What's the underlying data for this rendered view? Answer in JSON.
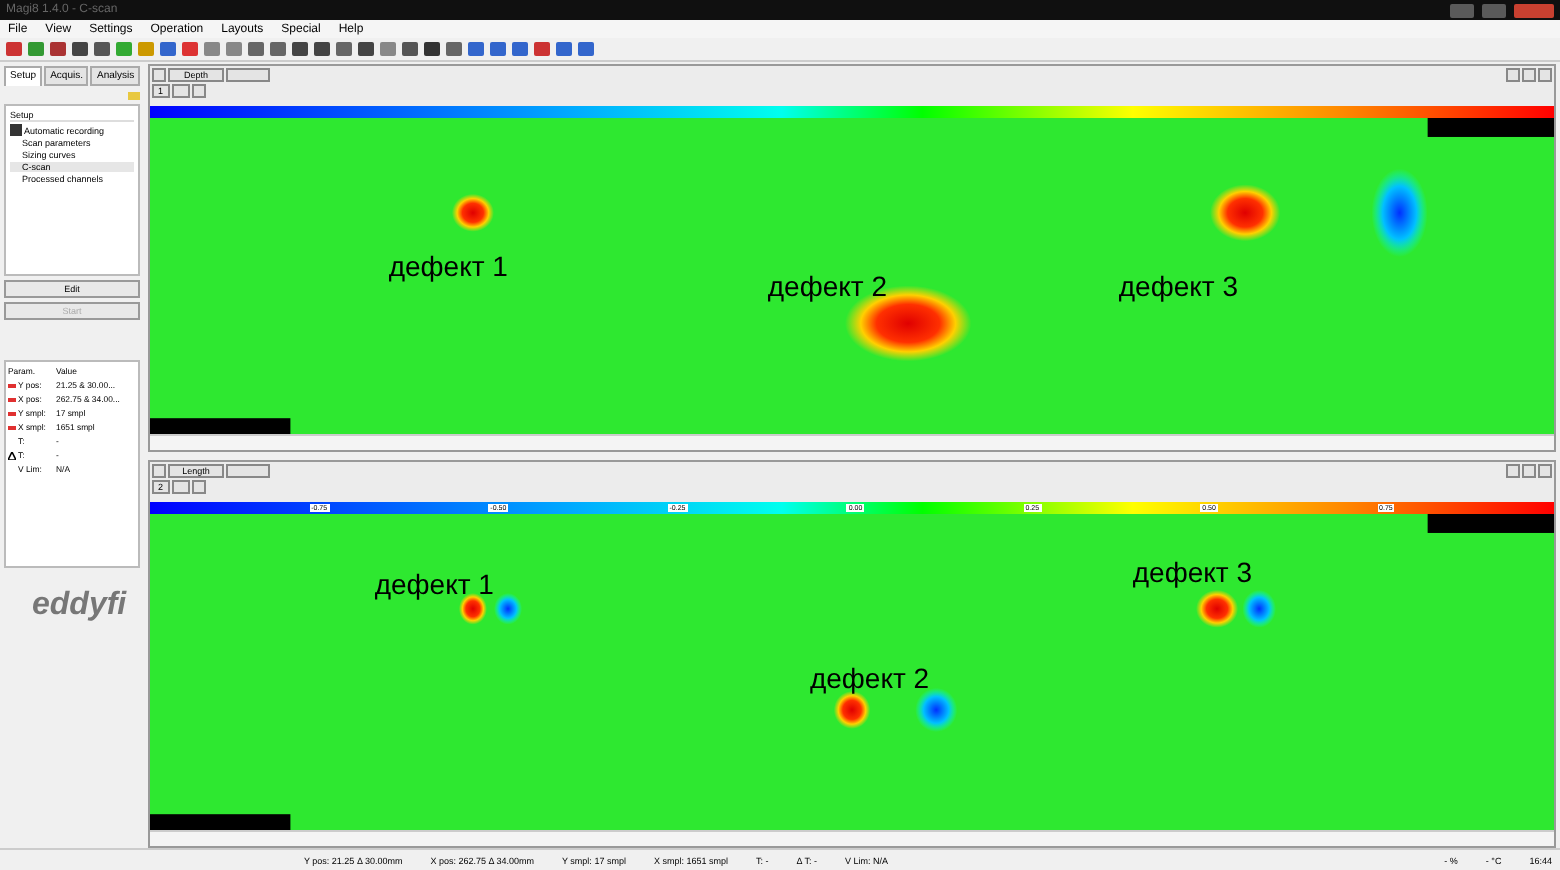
{
  "window": {
    "title": "Magi8 1.4.0 - C-scan"
  },
  "menu": [
    "File",
    "View",
    "Settings",
    "Operation",
    "Layouts",
    "Special",
    "Help"
  ],
  "left_panel": {
    "tabs": [
      {
        "label": "Setup",
        "selected": true
      },
      {
        "label": "Acquis.",
        "selected": false
      },
      {
        "label": "Analysis",
        "selected": false
      }
    ],
    "tree_title": "Setup",
    "tree": [
      {
        "label": "Automatic recording",
        "kind": "checkbox",
        "checked": true,
        "selected": false
      },
      {
        "label": "Scan parameters",
        "kind": "item",
        "selected": false
      },
      {
        "label": "Sizing curves",
        "kind": "item",
        "selected": false
      },
      {
        "label": "C-scan",
        "kind": "item",
        "selected": true
      },
      {
        "label": "Processed channels",
        "kind": "item",
        "selected": false
      }
    ],
    "buttons": [
      {
        "label": "Edit",
        "disabled": false
      },
      {
        "label": "Start",
        "disabled": true
      }
    ],
    "table": {
      "columns": [
        "Param.",
        "Value"
      ],
      "rows": [
        {
          "param": "Y pos:",
          "value": "21.25 & 30.00...",
          "color": "#e03030"
        },
        {
          "param": "X pos:",
          "value": "262.75 & 34.00...",
          "color": "#e03030"
        },
        {
          "param": "Y smpl:",
          "value": "17 smpl",
          "color": "#e03030"
        },
        {
          "param": "X smpl:",
          "value": "1651 smpl",
          "color": "#e03030"
        },
        {
          "param": "T:",
          "value": "-"
        },
        {
          "param": "T:",
          "value": "-",
          "delta": true
        },
        {
          "param": "V Lim:",
          "value": "N/A"
        }
      ]
    },
    "logo": "eddyfi"
  },
  "views": [
    {
      "number": "1",
      "axis": "Depth",
      "defects": [
        {
          "label": "дефект 1"
        },
        {
          "label": "дефект 2"
        },
        {
          "label": "дефект 3"
        }
      ]
    },
    {
      "number": "2",
      "axis": "Length",
      "ticks": [
        "-0.75",
        "-0.50",
        "-0.25",
        "0.00",
        "0.25",
        "0.50",
        "0.75"
      ],
      "defects": [
        {
          "label": "дефект 1"
        },
        {
          "label": "дефект 2"
        },
        {
          "label": "дефект 3"
        }
      ]
    }
  ],
  "status_bar": [
    "Y pos: 21.25 Δ 30.00mm",
    "X pos: 262.75 Δ 34.00mm",
    "Y smpl: 17 smpl",
    "X smpl: 1651 smpl",
    "T: -",
    "Δ T: -",
    "V Lim: N/A"
  ],
  "status_right": [
    "- %",
    "- °C",
    "16:44"
  ]
}
